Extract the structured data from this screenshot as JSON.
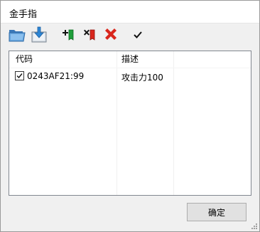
{
  "window": {
    "title": "金手指"
  },
  "toolbar": {
    "buttons": [
      {
        "icon": "open-folder-icon"
      },
      {
        "icon": "import-icon"
      },
      {
        "icon": "add-code-icon"
      },
      {
        "icon": "remove-code-icon"
      },
      {
        "icon": "delete-icon"
      },
      {
        "icon": "check-icon"
      }
    ]
  },
  "list": {
    "columns": [
      "代码",
      "描述"
    ],
    "rows": [
      {
        "checked": true,
        "code": "0243AF21:99",
        "description": "攻击力100"
      }
    ]
  },
  "footer": {
    "ok_label": "确定"
  },
  "colors": {
    "accent_green": "#1e9e3a",
    "accent_red": "#d9261c",
    "folder_blue": "#4a8fd0"
  }
}
